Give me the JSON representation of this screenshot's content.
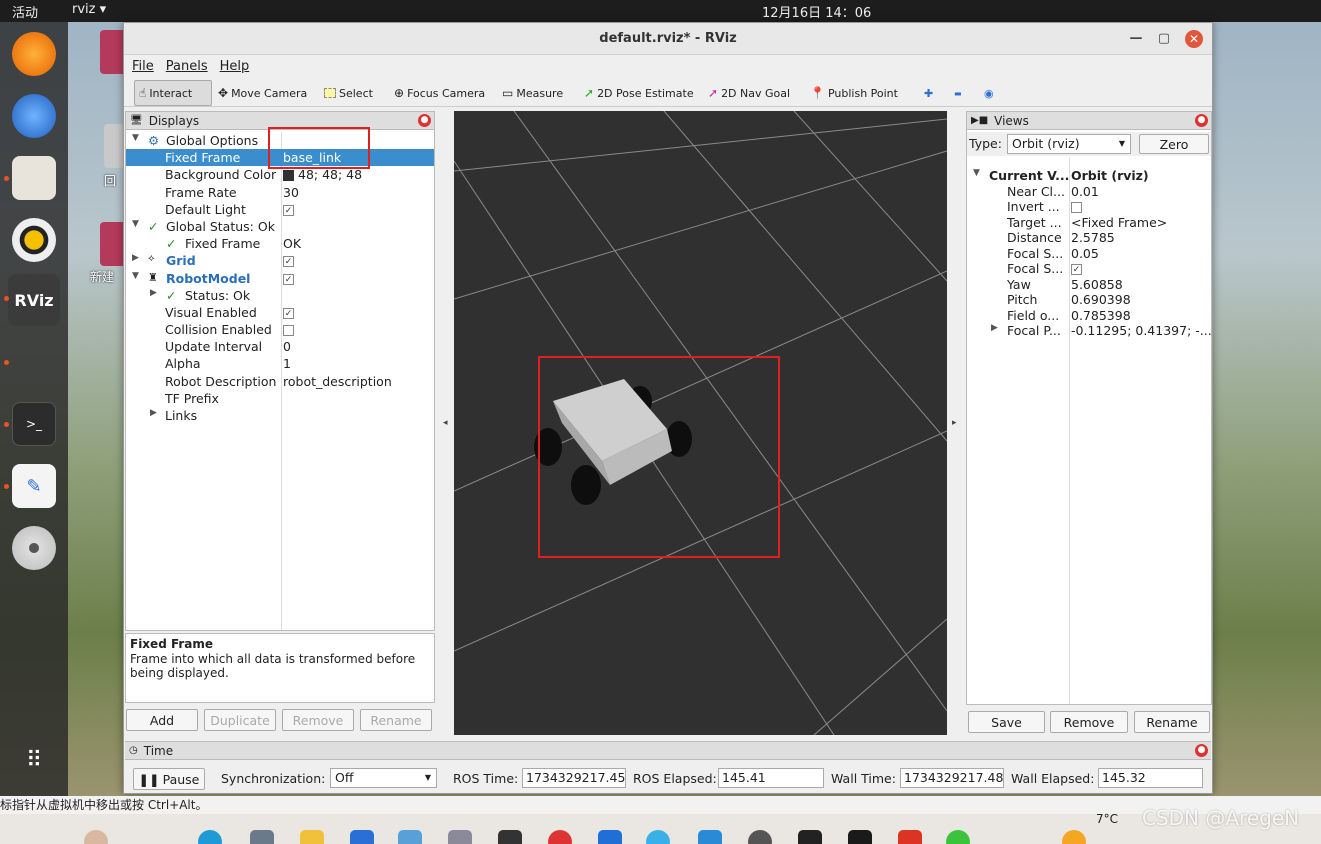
{
  "topbar": {
    "activities": "活动",
    "app": "rviz ▾",
    "clock": "12月16日  14：06"
  },
  "desktop": {
    "label1": "回",
    "label2": "新建"
  },
  "window": {
    "title": "default.rviz* - RViz",
    "min": "—",
    "max": "▢",
    "close": "✕"
  },
  "menu": {
    "file": "File",
    "panels": "Panels",
    "help": "Help"
  },
  "toolbar": {
    "interact": "Interact",
    "move_camera": "Move Camera",
    "select": "Select",
    "focus_camera": "Focus Camera",
    "measure": "Measure",
    "pose_estimate": "2D Pose Estimate",
    "nav_goal": "2D Nav Goal",
    "publish_point": "Publish Point",
    "plus": "✚",
    "minus": "▬",
    "eye": "◉"
  },
  "displays": {
    "header": "Displays",
    "global_options": "Global Options",
    "fixed_frame": "Fixed Frame",
    "fixed_frame_value": "base_link",
    "background_color": "Background Color",
    "background_color_value": "48; 48; 48",
    "frame_rate": "Frame Rate",
    "frame_rate_value": "30",
    "default_light": "Default Light",
    "global_status": "Global Status: Ok",
    "gs_fixed_frame": "Fixed Frame",
    "gs_fixed_frame_value": "OK",
    "grid": "Grid",
    "robot_model": "RobotModel",
    "status": "Status: Ok",
    "visual_enabled": "Visual Enabled",
    "collision_enabled": "Collision Enabled",
    "update_interval": "Update Interval",
    "update_interval_value": "0",
    "alpha": "Alpha",
    "alpha_value": "1",
    "robot_description": "Robot Description",
    "robot_description_value": "robot_description",
    "tf_prefix": "TF Prefix",
    "links": "Links"
  },
  "description": {
    "title": "Fixed Frame",
    "text": "Frame into which all data is transformed before being displayed."
  },
  "display_buttons": {
    "add": "Add",
    "duplicate": "Duplicate",
    "remove": "Remove",
    "rename": "Rename"
  },
  "views": {
    "header": "Views",
    "type_label": "Type:",
    "type_value": "Orbit (rviz)",
    "zero": "Zero",
    "current_view": "Current V...",
    "current_view_value": "Orbit (rviz)",
    "rows": [
      {
        "name": "Near Cl...",
        "value": "0.01"
      },
      {
        "name": "Invert ...",
        "value": ""
      },
      {
        "name": "Target ...",
        "value": "<Fixed Frame>"
      },
      {
        "name": "Distance",
        "value": "2.5785"
      },
      {
        "name": "Focal S...",
        "value": "0.05"
      },
      {
        "name": "Focal S...",
        "value": ""
      },
      {
        "name": "Yaw",
        "value": "5.60858"
      },
      {
        "name": "Pitch",
        "value": "0.690398"
      },
      {
        "name": "Field o...",
        "value": "0.785398"
      },
      {
        "name": "Focal P...",
        "value": "-0.11295; 0.41397; -..."
      }
    ],
    "save": "Save",
    "remove": "Remove",
    "rename": "Rename"
  },
  "time": {
    "header": "Time",
    "pause": "Pause",
    "sync_label": "Synchronization:",
    "sync_value": "Off",
    "ros_time_label": "ROS Time:",
    "ros_time": "1734329217.45",
    "ros_elapsed_label": "ROS Elapsed:",
    "ros_elapsed": "145.41",
    "wall_time_label": "Wall Time:",
    "wall_time": "1734329217.48",
    "wall_elapsed_label": "Wall Elapsed:",
    "wall_elapsed": "145.32"
  },
  "statusline": "标指针从虚拟机中移出或按 Ctrl+Alt。",
  "weather": "7°C",
  "watermark": "CSDN @AregeN",
  "colors": {
    "selection": "#3a8ecd",
    "viewport_bg": "#303030",
    "highlight": "#e02020"
  }
}
